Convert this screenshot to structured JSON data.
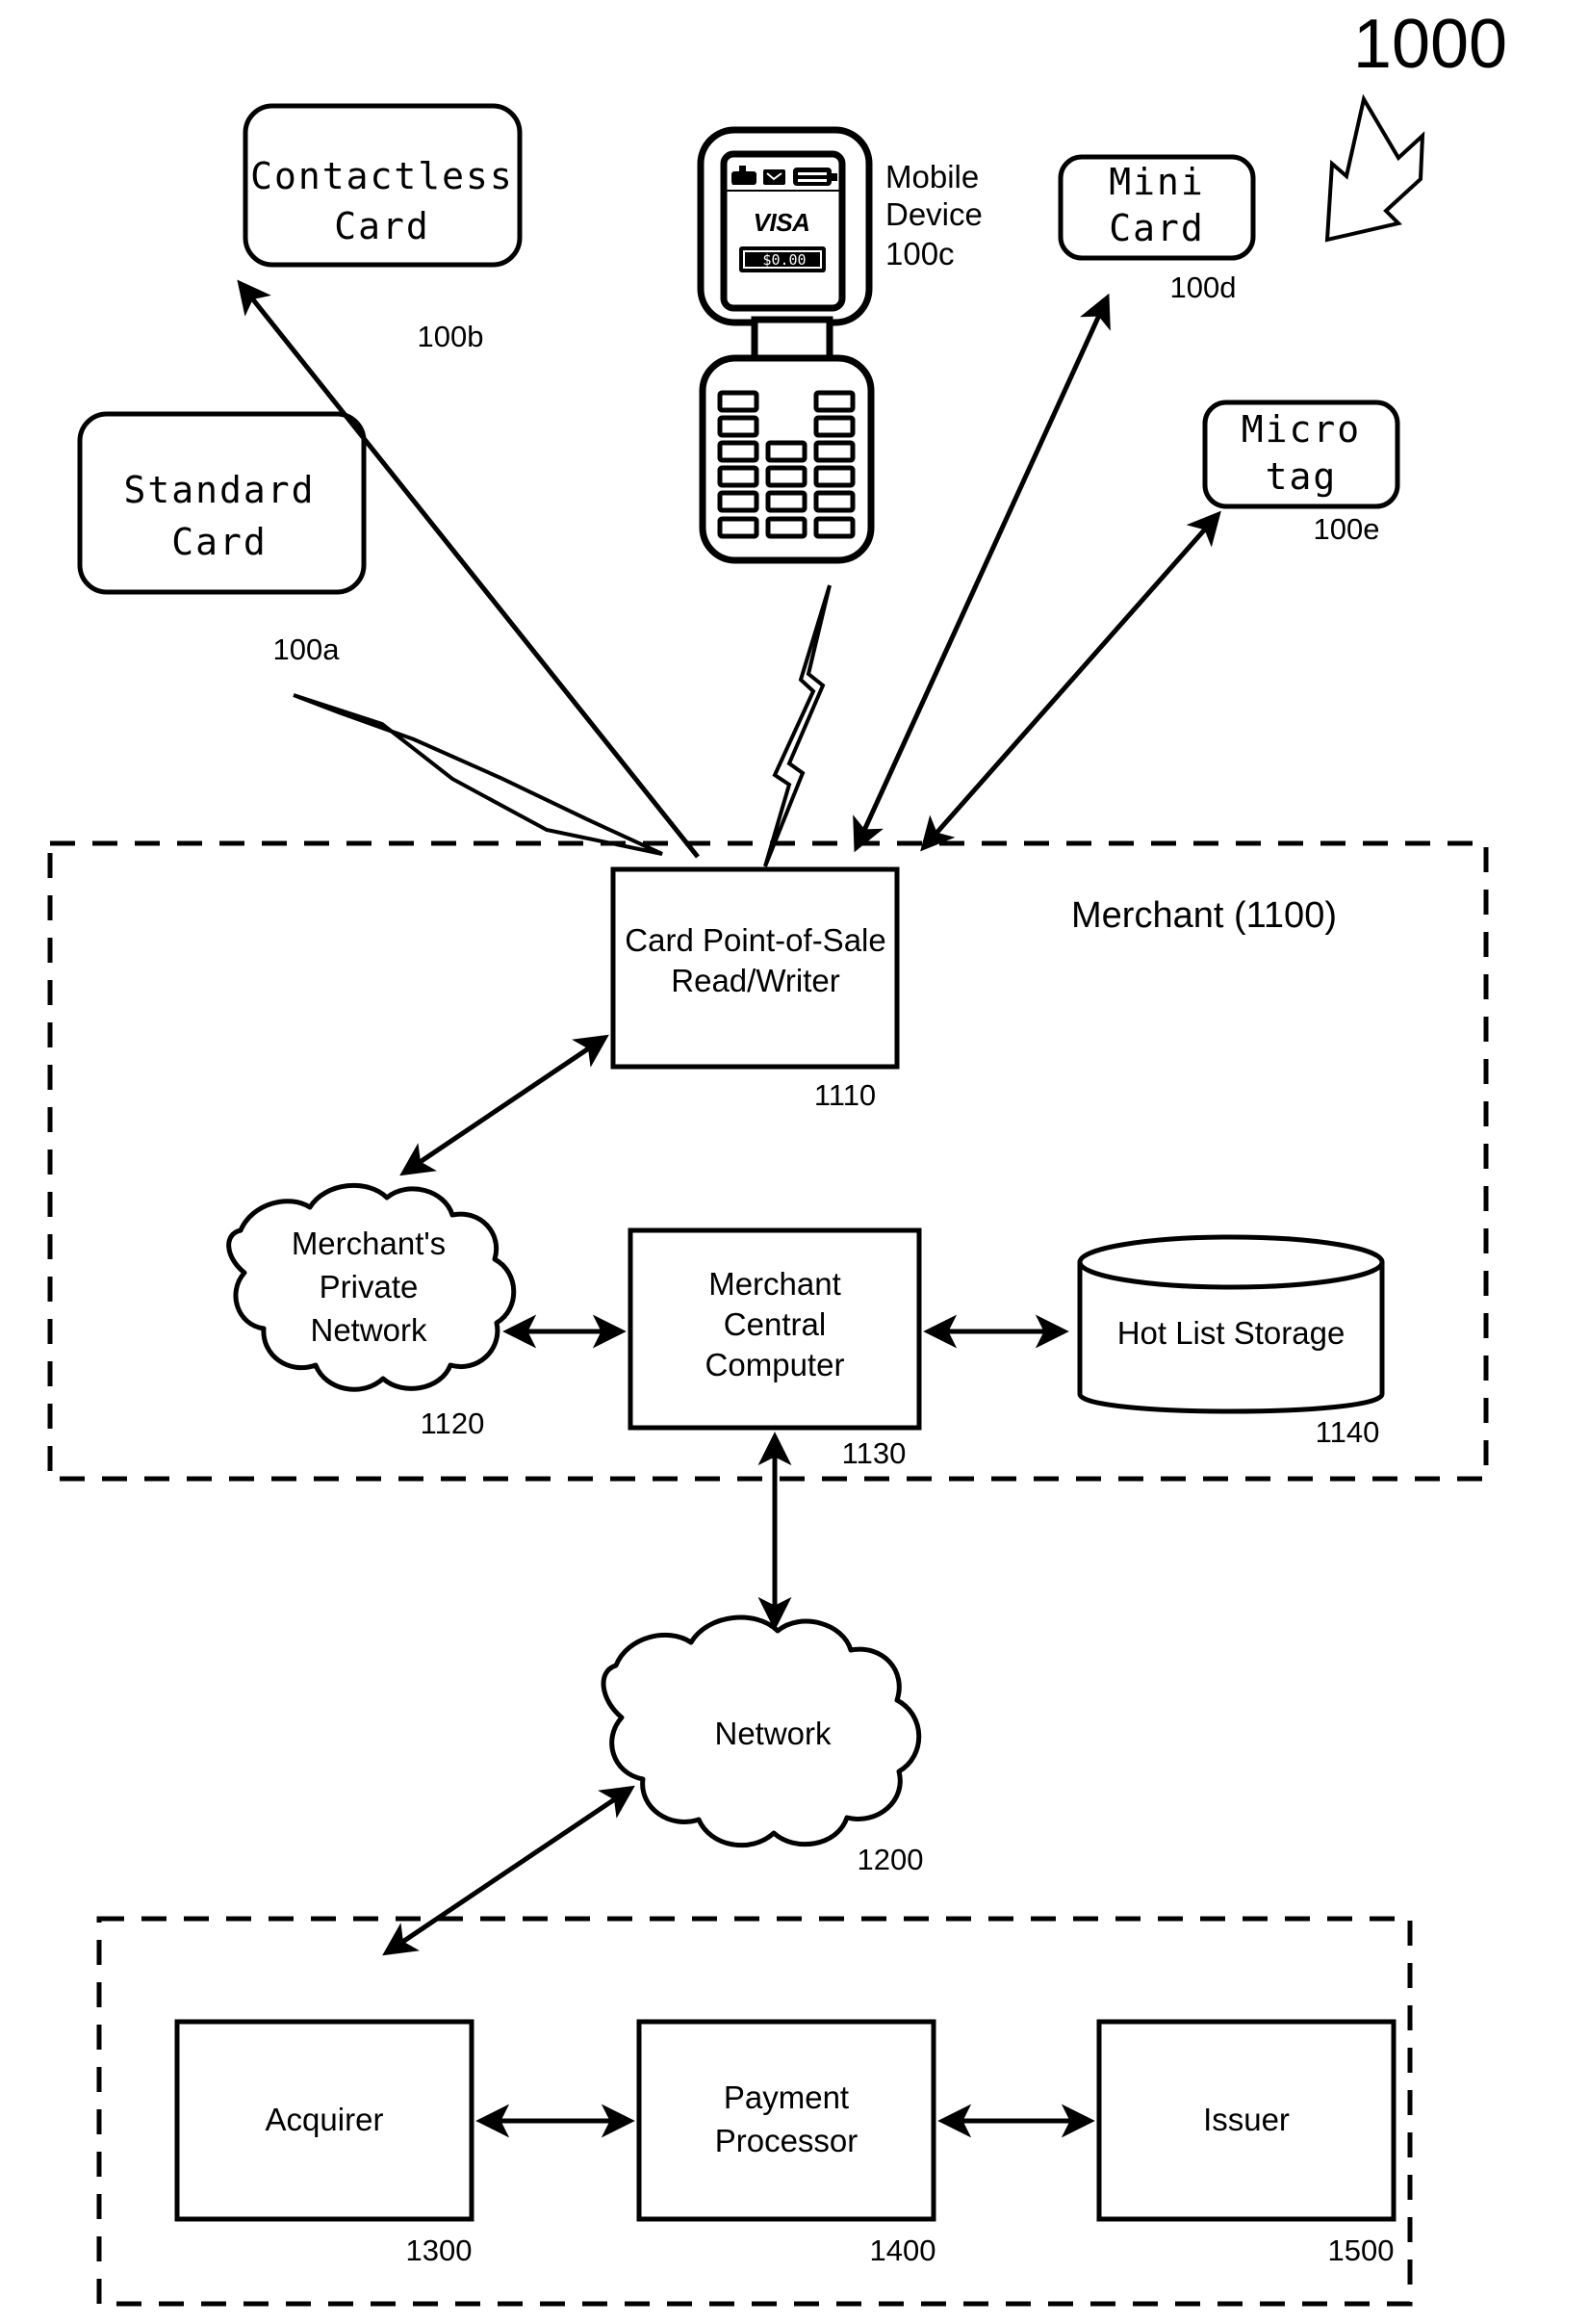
{
  "figure": {
    "number": "1000",
    "pointer_icon": "hollow-block-arrow-down-left"
  },
  "devices": [
    {
      "id": "100b",
      "label_line1": "Contactless",
      "label_line2": "Card",
      "ref": "100b"
    },
    {
      "id": "100a",
      "label_line1": "Standard",
      "label_line2": "Card",
      "ref": "100a"
    },
    {
      "id": "100d",
      "label_line1": "Mini",
      "label_line2": "Card",
      "ref": "100d"
    },
    {
      "id": "100e",
      "label_line1": "Micro",
      "label_line2": "tag",
      "ref": "100e"
    }
  ],
  "mobile_device": {
    "caption_line1": "Mobile",
    "caption_line2": "Device",
    "ref": "100c",
    "screen": {
      "brand": "VISA",
      "amount": "$0.00",
      "status_icons": [
        "signal-bars-icon",
        "message-icon",
        "battery-icon"
      ]
    }
  },
  "merchant": {
    "title": "Merchant (1100)",
    "ref": "1100",
    "nodes": [
      {
        "name": "pos",
        "label_line1": "Card Point-of-Sale",
        "label_line2": "Read/Writer",
        "ref": "1110"
      },
      {
        "name": "private-network",
        "label_line1": "Merchant's",
        "label_line2": "Private",
        "label_line3": "Network",
        "ref": "1120"
      },
      {
        "name": "central-computer",
        "label_line1": "Merchant",
        "label_line2": "Central",
        "label_line3": "Computer",
        "ref": "1130"
      },
      {
        "name": "hot-list-storage",
        "label_line1": "Hot List Storage",
        "ref": "1140"
      }
    ]
  },
  "network": {
    "label": "Network",
    "ref": "1200"
  },
  "backend": {
    "nodes": [
      {
        "name": "acquirer",
        "label_line1": "Acquirer",
        "ref": "1300"
      },
      {
        "name": "payment-processor",
        "label_line1": "Payment",
        "label_line2": "Processor",
        "ref": "1400"
      },
      {
        "name": "issuer",
        "label_line1": "Issuer",
        "ref": "1500"
      }
    ]
  },
  "colors": {
    "ink": "#000000",
    "paper": "#ffffff"
  }
}
